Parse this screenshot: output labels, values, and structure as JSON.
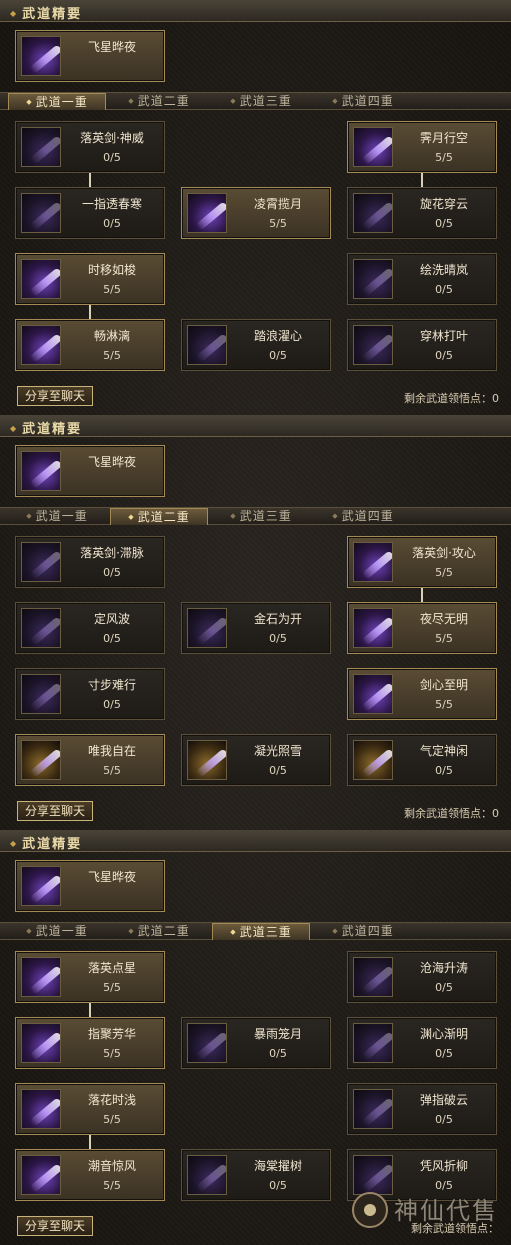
{
  "panels": [
    {
      "title": "武道精要",
      "feature": {
        "name": "飞星晔夜"
      },
      "tabs": [
        "武道一重",
        "武道二重",
        "武道三重",
        "武道四重"
      ],
      "active_tab": 0,
      "skills": [
        {
          "name": "落英剑·神威",
          "level": "0/5",
          "col": 0,
          "row": 0,
          "active": false,
          "icon": "sword-slash-icon"
        },
        {
          "name": "霁月行空",
          "level": "5/5",
          "col": 2,
          "row": 0,
          "active": true,
          "icon": "shadow-figure-icon"
        },
        {
          "name": "一指透春寒",
          "level": "0/5",
          "col": 0,
          "row": 1,
          "active": false,
          "icon": "finger-strike-icon"
        },
        {
          "name": "凌霄揽月",
          "level": "5/5",
          "col": 1,
          "row": 1,
          "active": true,
          "icon": "moon-vortex-icon"
        },
        {
          "name": "旋花穿云",
          "level": "0/5",
          "col": 2,
          "row": 1,
          "active": false,
          "icon": "sword-slash-icon"
        },
        {
          "name": "时移如梭",
          "level": "5/5",
          "col": 0,
          "row": 2,
          "active": true,
          "icon": "sword-slash-icon"
        },
        {
          "name": "绘洗晴岚",
          "level": "0/5",
          "col": 2,
          "row": 2,
          "active": false,
          "icon": "sword-slash-icon"
        },
        {
          "name": "畅淋漓",
          "level": "5/5",
          "col": 0,
          "row": 3,
          "active": true,
          "icon": "sword-slash-icon"
        },
        {
          "name": "踏浪濯心",
          "level": "0/5",
          "col": 1,
          "row": 3,
          "active": false,
          "icon": "sword-slash-icon"
        },
        {
          "name": "穿林打叶",
          "level": "0/5",
          "col": 2,
          "row": 3,
          "active": false,
          "icon": "sword-slash-icon"
        }
      ],
      "links": [
        [
          0,
          0,
          0,
          1
        ],
        [
          2,
          0,
          2,
          1
        ],
        [
          0,
          2,
          0,
          3
        ]
      ],
      "share_label": "分享至聊天",
      "remaining_label": "剩余武道领悟点：",
      "remaining_value": "0"
    },
    {
      "title": "武道精要",
      "feature": {
        "name": "飞星晔夜"
      },
      "tabs": [
        "武道一重",
        "武道二重",
        "武道三重",
        "武道四重"
      ],
      "active_tab": 1,
      "skills": [
        {
          "name": "落英剑·滞脉",
          "level": "0/5",
          "col": 0,
          "row": 0,
          "active": false,
          "icon": "sword-slash-icon"
        },
        {
          "name": "落英剑·攻心",
          "level": "5/5",
          "col": 2,
          "row": 0,
          "active": true,
          "icon": "sword-slash-icon"
        },
        {
          "name": "定风波",
          "level": "0/5",
          "col": 0,
          "row": 1,
          "active": false,
          "icon": "sword-slash-icon"
        },
        {
          "name": "金石为开",
          "level": "0/5",
          "col": 1,
          "row": 1,
          "active": false,
          "icon": "sword-slash-icon"
        },
        {
          "name": "夜尽无明",
          "level": "5/5",
          "col": 2,
          "row": 1,
          "active": true,
          "icon": "light-rays-icon"
        },
        {
          "name": "寸步难行",
          "level": "0/5",
          "col": 0,
          "row": 2,
          "active": false,
          "icon": "sword-slash-icon"
        },
        {
          "name": "剑心至明",
          "level": "5/5",
          "col": 2,
          "row": 2,
          "active": true,
          "icon": "sword-slash-icon"
        },
        {
          "name": "唯我自在",
          "level": "5/5",
          "col": 0,
          "row": 3,
          "active": true,
          "icon": "warrior-figure-icon"
        },
        {
          "name": "凝光照雪",
          "level": "0/5",
          "col": 1,
          "row": 3,
          "active": false,
          "icon": "golden-light-icon"
        },
        {
          "name": "气定神闲",
          "level": "0/5",
          "col": 2,
          "row": 3,
          "active": false,
          "icon": "golden-aura-icon"
        }
      ],
      "links": [
        [
          2,
          0,
          2,
          1
        ]
      ],
      "share_label": "分享至聊天",
      "remaining_label": "剩余武道领悟点：",
      "remaining_value": "0"
    },
    {
      "title": "武道精要",
      "feature": {
        "name": "飞星晔夜"
      },
      "tabs": [
        "武道一重",
        "武道二重",
        "武道三重",
        "武道四重"
      ],
      "active_tab": 2,
      "skills": [
        {
          "name": "落英点星",
          "level": "5/5",
          "col": 0,
          "row": 0,
          "active": true,
          "icon": "sword-slash-icon"
        },
        {
          "name": "沧海升涛",
          "level": "0/5",
          "col": 2,
          "row": 0,
          "active": false,
          "icon": "sword-slash-icon"
        },
        {
          "name": "指聚芳华",
          "level": "5/5",
          "col": 0,
          "row": 1,
          "active": true,
          "icon": "sword-slash-icon"
        },
        {
          "name": "暴雨笼月",
          "level": "0/5",
          "col": 1,
          "row": 1,
          "active": false,
          "icon": "light-rays-icon"
        },
        {
          "name": "渊心渐明",
          "level": "0/5",
          "col": 2,
          "row": 1,
          "active": false,
          "icon": "sword-slash-icon"
        },
        {
          "name": "落花时浅",
          "level": "5/5",
          "col": 0,
          "row": 2,
          "active": true,
          "icon": "sword-slash-icon"
        },
        {
          "name": "弹指破云",
          "level": "0/5",
          "col": 2,
          "row": 2,
          "active": false,
          "icon": "sword-slash-icon"
        },
        {
          "name": "潮音惊风",
          "level": "5/5",
          "col": 0,
          "row": 3,
          "active": true,
          "icon": "sword-slash-icon"
        },
        {
          "name": "海棠擢树",
          "level": "0/5",
          "col": 1,
          "row": 3,
          "active": false,
          "icon": "sword-slash-icon"
        },
        {
          "name": "凭风折柳",
          "level": "0/5",
          "col": 2,
          "row": 3,
          "active": false,
          "icon": "sword-slash-icon"
        }
      ],
      "links": [
        [
          0,
          0,
          0,
          1
        ],
        [
          0,
          2,
          0,
          3
        ]
      ],
      "share_label": "分享至聊天",
      "remaining_label": "剩余武道领悟点：",
      "remaining_value": ""
    }
  ],
  "watermark": {
    "text": "神仙代售"
  },
  "colors": {
    "active_border": "#a48a55",
    "accent_gold": "#c9a14a",
    "purple_glow": "#6d43b8"
  }
}
